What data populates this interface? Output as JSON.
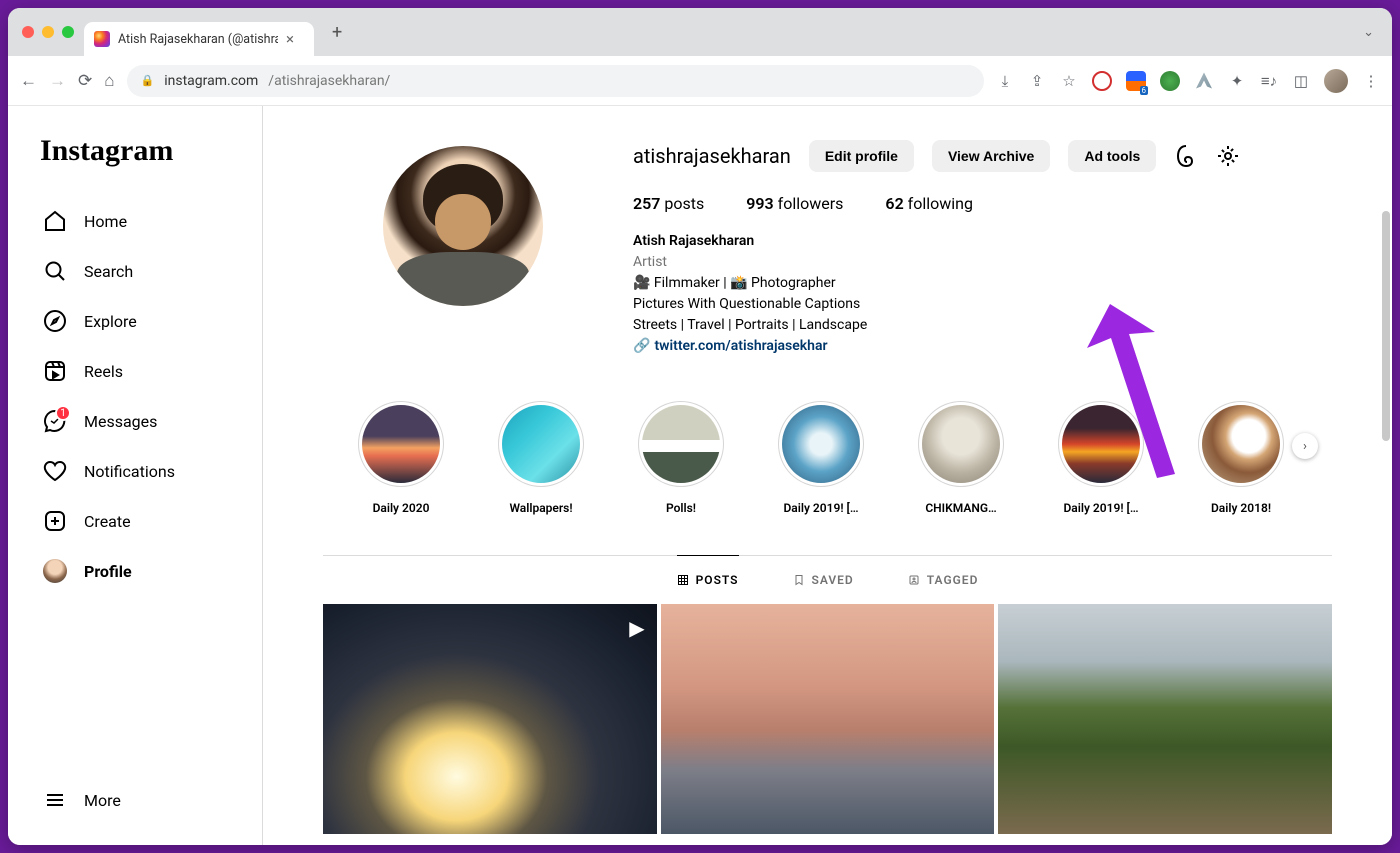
{
  "browser": {
    "tab_title": "Atish Rajasekharan (@atishraja",
    "url_domain": "instagram.com",
    "url_path": "/atishrajasekharan/"
  },
  "sidebar": {
    "logo": "Instagram",
    "items": [
      {
        "label": "Home",
        "icon": "home-icon"
      },
      {
        "label": "Search",
        "icon": "search-icon"
      },
      {
        "label": "Explore",
        "icon": "explore-icon"
      },
      {
        "label": "Reels",
        "icon": "reels-icon"
      },
      {
        "label": "Messages",
        "icon": "messages-icon",
        "badge": "1"
      },
      {
        "label": "Notifications",
        "icon": "notifications-icon"
      },
      {
        "label": "Create",
        "icon": "create-icon"
      },
      {
        "label": "Profile",
        "icon": "profile-avatar",
        "active": true
      }
    ],
    "more_label": "More"
  },
  "profile": {
    "username": "atishrajasekharan",
    "buttons": {
      "edit": "Edit profile",
      "archive": "View Archive",
      "adtools": "Ad tools"
    },
    "stats": {
      "posts_count": "257",
      "posts_label": "posts",
      "followers_count": "993",
      "followers_label": "followers",
      "following_count": "62",
      "following_label": "following"
    },
    "bio": {
      "name": "Atish Rajasekharan",
      "category": "Artist",
      "line1": "🎥 Filmmaker | 📸 Photographer",
      "line2": "Pictures With Questionable Captions",
      "line3": "Streets | Travel | Portraits | Landscape",
      "link": "twitter.com/atishrajasekhar"
    }
  },
  "highlights": [
    {
      "label": "Daily 2020"
    },
    {
      "label": "Wallpapers!"
    },
    {
      "label": "Polls!"
    },
    {
      "label": "Daily 2019! […"
    },
    {
      "label": "CHIKMANG…"
    },
    {
      "label": "Daily 2019! […"
    },
    {
      "label": "Daily 2018!"
    }
  ],
  "tabs": {
    "posts": "Posts",
    "saved": "Saved",
    "tagged": "Tagged"
  },
  "annotation": {
    "arrow_color": "#9c27e0"
  }
}
